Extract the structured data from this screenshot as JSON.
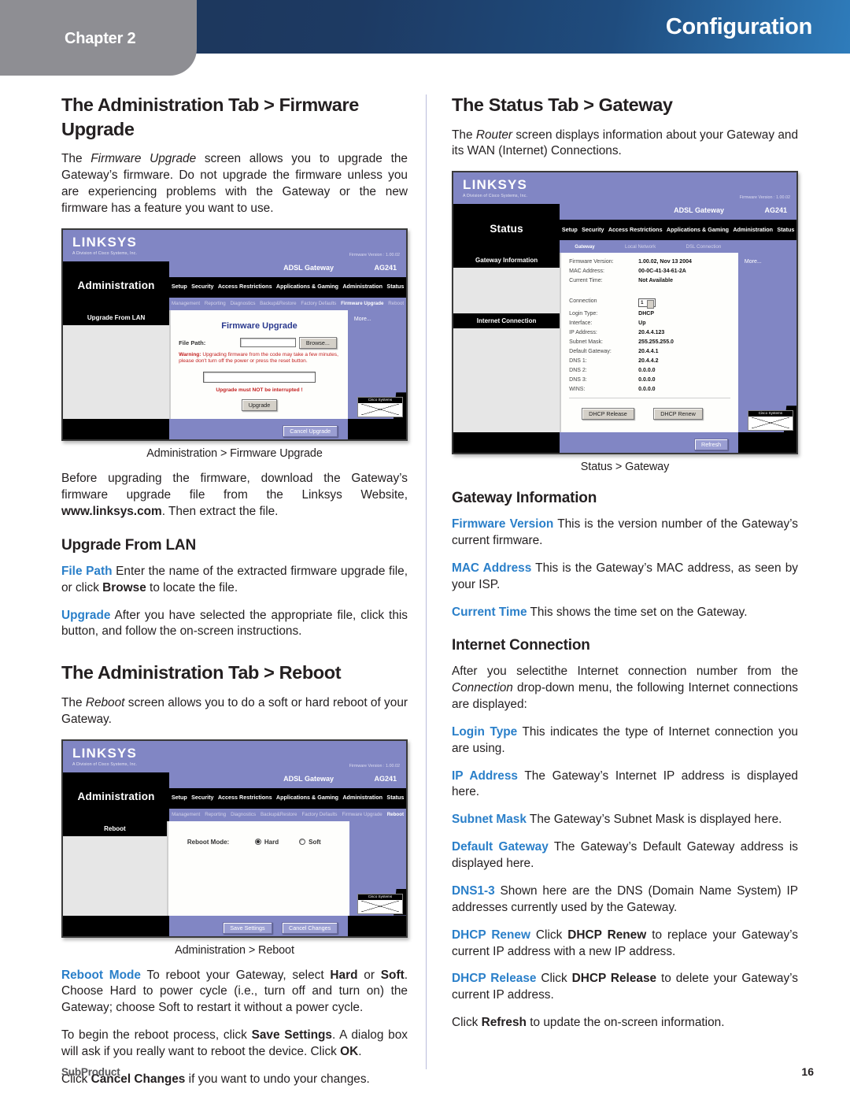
{
  "header": {
    "chapter_label": "Chapter 2",
    "title": "Configuration",
    "accent_dark": "#1d3557",
    "accent_light": "#2f7cbb",
    "chapter_tab_color": "#8e8e93"
  },
  "footer": {
    "left": "SubProduct",
    "page_number": "16"
  },
  "left_column": {
    "heading1": "The Administration Tab > Firmware Upgrade",
    "intro_p1_a": "The ",
    "intro_p1_i": "Firmware Upgrade",
    "intro_p1_b": " screen allows you to upgrade the Gateway’s firmware. Do not upgrade the firmware unless you are experiencing problems with the Gateway or the new firmware has a feature you want to use.",
    "figure1_caption": "Administration > Firmware Upgrade",
    "para_before_a": "Before upgrading the firmware, download the Gateway’s firmware upgrade file from the Linksys Website, ",
    "para_before_b": "www.linksys.com",
    "para_before_c": ". Then extract the file.",
    "heading2": "Upgrade From LAN",
    "filepath_kw": "File Path",
    "filepath_a": " Enter the name of the extracted firmware upgrade file, or click ",
    "filepath_b": "Browse",
    "filepath_c": " to locate the file.",
    "upgrade_kw": "Upgrade",
    "upgrade_a": " After you have selected the appropriate file, click this button, and follow the on-screen instructions.",
    "heading3": "The Administration Tab > Reboot",
    "reboot_intro_a": "The ",
    "reboot_intro_i": "Reboot",
    "reboot_intro_b": " screen allows you to do a soft or hard reboot of your Gateway.",
    "figure2_caption": "Administration > Reboot",
    "rebootmode_kw": "Reboot Mode",
    "rebootmode_a": " To reboot your Gateway, select ",
    "rebootmode_b": "Hard",
    "rebootmode_c": " or ",
    "rebootmode_d": "Soft",
    "rebootmode_e": ". Choose Hard to power cycle (i.e., turn off and turn on) the Gateway; choose Soft to restart it without a power cycle.",
    "begin_a": "To begin the reboot process, click ",
    "begin_b": "Save Settings",
    "begin_c": ". A dialog box will ask if you really want to reboot the device. Click ",
    "begin_d": "OK",
    "begin_e": ".",
    "cancel_a": "Click ",
    "cancel_b": "Cancel Changes",
    "cancel_c": " if you want to undo your changes."
  },
  "right_column": {
    "heading1": "The Status Tab > Gateway",
    "intro_a": "The ",
    "intro_i": "Router",
    "intro_b": " screen displays information about your Gateway and its WAN (Internet) Connections.",
    "figure1_caption": "Status > Gateway",
    "heading2": "Gateway Information",
    "fw_kw": "Firmware Version",
    "fw_a": " This is the version number of the Gateway’s current firmware.",
    "mac_kw": "MAC Address",
    "mac_a": "  This is the Gateway’s MAC address, as seen by your ISP.",
    "time_kw": "Current Time",
    "time_a": "  This shows the time set on the Gateway.",
    "heading3": "Internet Connection",
    "ic_a": "After you selectithe Internet connection number from the ",
    "ic_i": "Connection",
    "ic_b": " drop-down menu, the following Internet connections are displayed:",
    "login_kw": "Login Type",
    "login_a": "  This indicates the type of Internet connection you are using.",
    "ip_kw": "IP Address",
    "ip_a": "  The Gateway’s Internet IP address is displayed here.",
    "subnet_kw": "Subnet Mask",
    "subnet_a": " The Gateway’s Subnet Mask is displayed here.",
    "defgw_kw": "Default Gateway",
    "defgw_a": " The Gateway’s Default Gateway address is displayed here.",
    "dns_kw": "DNS1-3",
    "dns_a": "  Shown here are the DNS (Domain Name System) IP addresses currently used by the Gateway.",
    "renew_kw": "DHCP Renew",
    "renew_a": " Click ",
    "renew_b": "DHCP Renew",
    "renew_c": " to replace your Gateway’s current IP address with a new IP address.",
    "release_kw": "DHCP Release",
    "release_a": " Click ",
    "release_b": "DHCP Release",
    "release_c": " to delete your Gateway’s current IP address.",
    "refresh_a": "Click ",
    "refresh_b": "Refresh",
    "refresh_c": " to update the on-screen information."
  },
  "figures": {
    "firmware_upgrade": {
      "brand": "LINKSYS",
      "brand_sub": "A Division of Cisco Systems, Inc.",
      "firmware_label": "Firmware Version : 1.00.02",
      "section_title": "Administration",
      "model": "ADSL Gateway",
      "model_code": "AG241",
      "tabs": [
        "Setup",
        "Security",
        "Access Restrictions",
        "Applications & Gaming",
        "Administration",
        "Status"
      ],
      "active_tab": "Administration",
      "subtabs": [
        "Management",
        "Reporting",
        "Diagnostics",
        "Backup&Restore",
        "Factory Defaults",
        "Firmware Upgrade",
        "Reboot"
      ],
      "active_subtab": "Firmware Upgrade",
      "side_heading": "Upgrade From LAN",
      "form_title": "Firmware Upgrade",
      "field_label": "File Path:",
      "browse_button": "Browse...",
      "warning_bold": "Warning:",
      "warning_text": " Upgrading firmware from the code may take a few minutes, please don't turn off the power or press the reset button.",
      "progress_text": "Upgrade must NOT be interrupted !",
      "upgrade_button": "Upgrade",
      "footer_button": "Cancel Upgrade",
      "help_label": "More...",
      "cisco_label": "Cisco Systems"
    },
    "reboot": {
      "brand": "LINKSYS",
      "brand_sub": "A Division of Cisco Systems, Inc.",
      "firmware_label": "Firmware Version : 1.00.02",
      "section_title": "Administration",
      "model": "ADSL Gateway",
      "model_code": "AG241",
      "tabs": [
        "Setup",
        "Security",
        "Access Restrictions",
        "Applications & Gaming",
        "Administration",
        "Status"
      ],
      "active_tab": "Administration",
      "subtabs": [
        "Management",
        "Reporting",
        "Diagnostics",
        "Backup&Restore",
        "Factory Defaults",
        "Firmware Upgrade",
        "Reboot"
      ],
      "active_subtab": "Reboot",
      "side_heading": "Reboot",
      "mode_label": "Reboot Mode:",
      "option_hard": "Hard",
      "option_soft": "Soft",
      "selected_option": "Hard",
      "save_button": "Save Settings",
      "cancel_button": "Cancel Changes",
      "cisco_label": "Cisco Systems"
    },
    "status_gateway": {
      "brand": "LINKSYS",
      "brand_sub": "A Division of Cisco Systems, Inc.",
      "firmware_label": "Firmware Version : 1.00.02",
      "section_title": "Status",
      "model": "ADSL Gateway",
      "model_code": "AG241",
      "tabs": [
        "Setup",
        "Security",
        "Access Restrictions",
        "Applications & Gaming",
        "Administration",
        "Status"
      ],
      "active_tab": "Status",
      "subtabs": [
        "Gateway",
        "Local Network",
        "DSL Connection"
      ],
      "active_subtab": "Gateway",
      "side_heading_1": "Gateway Information",
      "side_heading_2": "Internet Connection",
      "help_label": "More...",
      "rows_gateway": [
        {
          "key": "Firmware Version:",
          "value": "1.00.02, Nov 13 2004"
        },
        {
          "key": "MAC Address:",
          "value": "00-0C-41-34-61-2A"
        },
        {
          "key": "Current Time:",
          "value": "Not Available"
        }
      ],
      "connection_key": "Connection",
      "connection_value": "1",
      "rows_internet": [
        {
          "key": "Login Type:",
          "value": "DHCP"
        },
        {
          "key": "Interface:",
          "value": "Up"
        },
        {
          "key": "IP Address:",
          "value": "20.4.4.123"
        },
        {
          "key": "Subnet Mask:",
          "value": "255.255.255.0"
        },
        {
          "key": "Default Gateway:",
          "value": "20.4.4.1"
        },
        {
          "key": "DNS 1:",
          "value": "20.4.4.2"
        },
        {
          "key": "DNS 2:",
          "value": "0.0.0.0"
        },
        {
          "key": "DNS 3:",
          "value": "0.0.0.0"
        },
        {
          "key": "WINS:",
          "value": "0.0.0.0"
        }
      ],
      "dhcp_release_button": "DHCP Release",
      "dhcp_renew_button": "DHCP Renew",
      "refresh_button": "Refresh",
      "cisco_label": "Cisco Systems"
    }
  }
}
